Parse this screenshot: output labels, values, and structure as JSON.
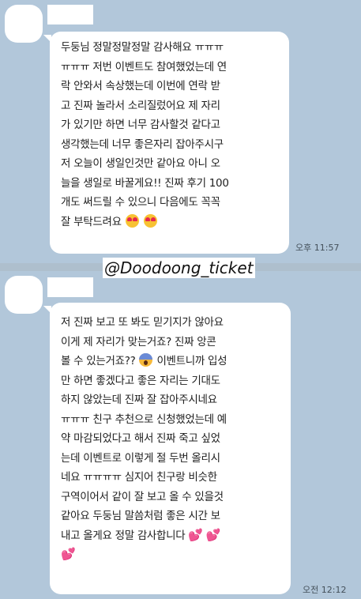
{
  "messages": [
    {
      "lines": [
        "두둥님 정말정말정말 감사해요 ㅠㅠㅠ",
        "ㅠㅠㅠ 저번 이벤트도 참여했었는데 연",
        "락 안와서 속상했는데 이번에 연락 받",
        "고 진짜 놀라서 소리질렀어요 제 자리",
        "가 있기만 하면 너무 감사할것 같다고",
        "생각했는데 너무 좋은자리 잡아주시구",
        "저 오늘이 생일인것만 같아요 아니 오",
        "늘을 생일로 바꿀게요!! 진짜 후기 100",
        "개도 써드릴 수 있으니 다음에도 꼭꼭",
        "잘 부탁드려요"
      ],
      "end_emojis": [
        "smiling-face-with-heart-eyes-icon",
        "smiling-face-with-heart-eyes-icon"
      ],
      "time": "오후 11:57"
    },
    {
      "lines_before_emoji": [
        "저 진짜 보고 또 봐도 믿기지가 않아요",
        "이게 제 자리가 맞는거죠? 진짜 앙콘"
      ],
      "emoji_line_start": "볼 수 있는거죠??",
      "emoji_line_end": "이벤트니까 입성",
      "inline_emoji": "face-screaming-in-fear-icon",
      "lines_after_emoji": [
        "만 하면 좋겠다고 좋은 자리는 기대도",
        "하지 않았는데 진짜 잘 잡아주시네요",
        "ㅠㅠㅠ 친구 추천으로 신청했었는데 예",
        "약 마감되었다고 해서 진짜 죽고 싶었",
        "는데 이벤트로 이렇게 절 두번 올리시",
        "네요 ㅠㅠㅠㅠ 심지어 친구랑 비슷한",
        "구역이어서 같이 잘 보고 올 수 있을것",
        "같아요 두둥님 말씀처럼 좋은 시간 보"
      ],
      "last_line": "내고 올게요 정말 감사합니다",
      "end_emojis": [
        "two-hearts-icon",
        "two-hearts-icon",
        "two-hearts-icon"
      ],
      "time": "오전 12:12"
    }
  ],
  "watermark": "@Doodoong_ticket",
  "colors": {
    "background": "#b2c7da",
    "bubble": "#ffffff",
    "text": "#1d1d1d",
    "time": "#44505a"
  }
}
